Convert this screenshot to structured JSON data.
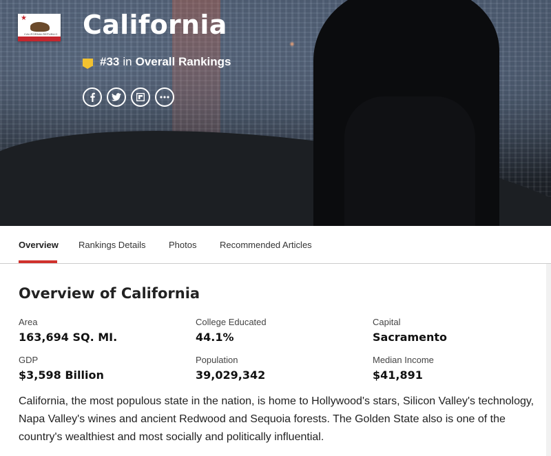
{
  "hero": {
    "state_name": "California",
    "flag_text": "CALIFORNIA REPUBLIC",
    "rank_number": "#33",
    "rank_in": "in",
    "rank_category": "Overall Rankings",
    "share_icons": [
      "facebook-icon",
      "twitter-icon",
      "flipboard-icon",
      "more-icon"
    ]
  },
  "tabs": [
    {
      "label": "Overview",
      "active": true
    },
    {
      "label": "Rankings Details",
      "active": false
    },
    {
      "label": "Photos",
      "active": false
    },
    {
      "label": "Recommended Articles",
      "active": false
    }
  ],
  "overview": {
    "title": "Overview of California",
    "stats": [
      {
        "label": "Area",
        "value": "163,694 SQ. MI."
      },
      {
        "label": "College Educated",
        "value": "44.1%"
      },
      {
        "label": "Capital",
        "value": "Sacramento"
      },
      {
        "label": "GDP",
        "value": "$3,598 Billion"
      },
      {
        "label": "Population",
        "value": "39,029,342"
      },
      {
        "label": "Median Income",
        "value": "$41,891"
      }
    ],
    "description": "California, the most populous state in the nation, is home to Hollywood's stars, Silicon Valley's technology, Napa Valley's wines and ancient Redwood and Sequoia forests. The Golden State also is one of the country's wealthiest and most socially and politically influential."
  },
  "colors": {
    "accent": "#d0312d",
    "badge": "#f2c230",
    "flag_red": "#c4262e"
  }
}
